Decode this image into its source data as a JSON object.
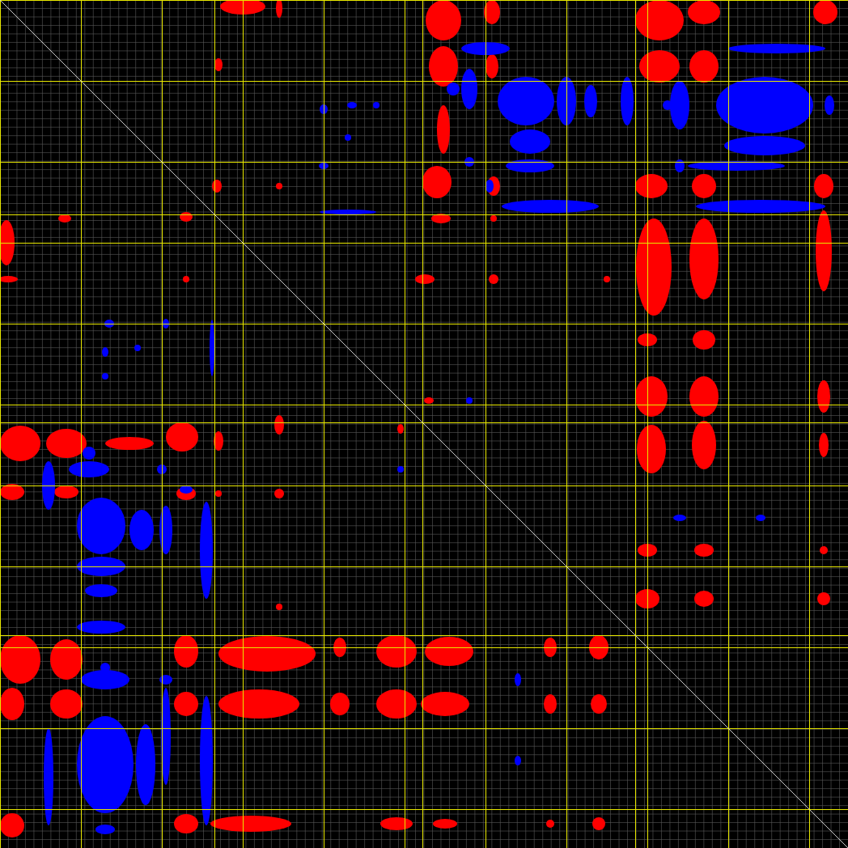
{
  "plot": {
    "kind": "dot-matrix",
    "series": [
      {
        "color": "#ff0000"
      },
      {
        "color": "#0000ff"
      }
    ]
  }
}
